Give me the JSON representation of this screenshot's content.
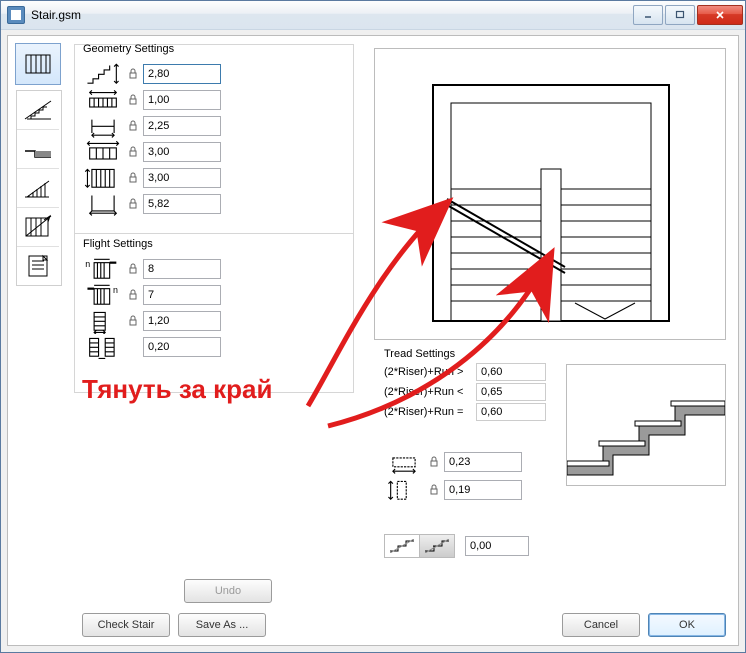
{
  "window": {
    "title": "Stair.gsm"
  },
  "geometry": {
    "title": "Geometry Settings",
    "rows": [
      {
        "v": "2,80",
        "focused": true
      },
      {
        "v": "1,00"
      },
      {
        "v": "2,25"
      },
      {
        "v": "3,00"
      },
      {
        "v": "3,00"
      },
      {
        "v": "5,82"
      }
    ]
  },
  "flight": {
    "title": "Flight Settings",
    "rows": [
      {
        "v": "8"
      },
      {
        "v": "7"
      },
      {
        "v": "1,20"
      },
      {
        "v": "0,20"
      }
    ]
  },
  "tread": {
    "title": "Tread Settings",
    "rows": [
      {
        "label": "(2*Riser)+Run >",
        "v": "0,60"
      },
      {
        "label": "(2*Riser)+Run <",
        "v": "0,65"
      },
      {
        "label": "(2*Riser)+Run =",
        "v": "0,60"
      }
    ],
    "inputs": [
      {
        "v": "0,23"
      },
      {
        "v": "0,19"
      }
    ]
  },
  "style": {
    "value": "0,00"
  },
  "buttons": {
    "undo": "Undo",
    "check": "Check Stair",
    "saveas": "Save As ...",
    "cancel": "Cancel",
    "ok": "OK"
  },
  "annotation": {
    "text": "Тянуть за край"
  }
}
